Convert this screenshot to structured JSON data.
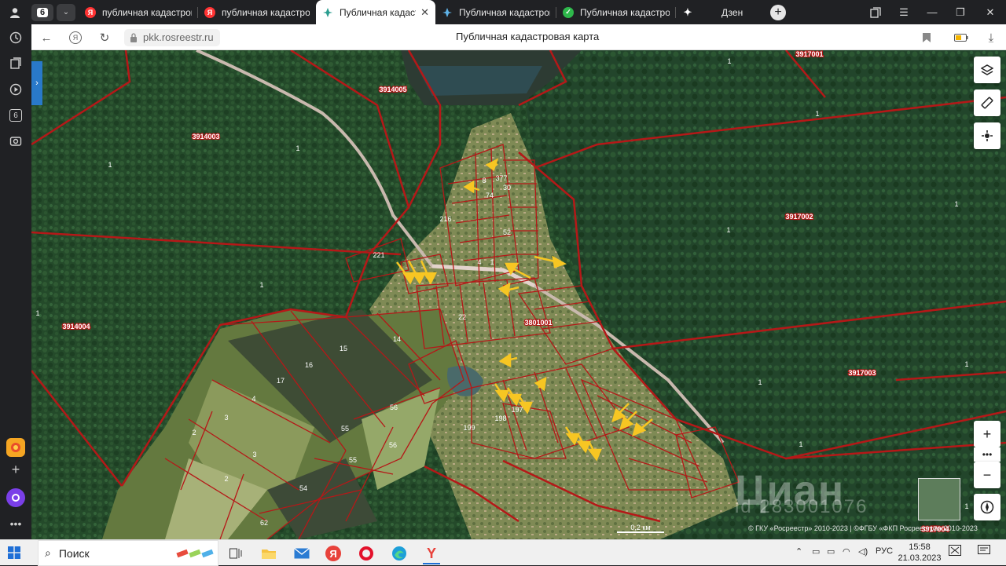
{
  "tabstrip": {
    "tab_count": "6",
    "tabs": [
      {
        "title": "публичная кадастрова",
        "icon": "yandex-icon",
        "active": false
      },
      {
        "title": "публичная кадастрова",
        "icon": "yandex-icon",
        "active": false
      },
      {
        "title": "Публичная кадастро",
        "icon": "rosreestr-icon",
        "active": true
      },
      {
        "title": "Публичная кадастрова",
        "icon": "rosreestr-icon",
        "active": false
      },
      {
        "title": "Публичная кадастрова",
        "icon": "check-icon",
        "active": false
      },
      {
        "title": "Дзен",
        "icon": "dzen-icon",
        "active": false
      }
    ]
  },
  "sidebar": {
    "icons": [
      "history-icon",
      "collections-icon",
      "media-icon",
      "tab-count-icon",
      "screenshot-icon"
    ],
    "tab_count_badge": "6"
  },
  "addressbar": {
    "url": "pkk.rosreestr.ru",
    "page_title": "Публичная кадастровая карта"
  },
  "map": {
    "quarters": [
      "3914005",
      "3914003",
      "3914004",
      "3917001",
      "3917002",
      "3917003",
      "3801001",
      "3917004"
    ],
    "parcel_numbers": [
      "1",
      "1",
      "1",
      "1",
      "1",
      "1",
      "1",
      "1",
      "1",
      "1",
      "1",
      "1",
      "1",
      "221",
      "216",
      "22",
      "15",
      "14",
      "16",
      "17",
      "4",
      "3",
      "3",
      "2",
      "2",
      "55",
      "55",
      "56",
      "56",
      "54",
      "62",
      "199",
      "198",
      "197",
      "74",
      "30",
      "8",
      "4",
      "377",
      "52"
    ],
    "scale_label": "0,2 км",
    "attribution": "© ГКУ «Росреестр» 2010-2023 | ©ФГБУ «ФКП Росреестра» 2010-2023",
    "watermark": "Циан",
    "watermark_id": "id 283001076",
    "controls": [
      "layers-icon",
      "ruler-icon",
      "locate-icon",
      "zoom-in-button",
      "more-icon",
      "zoom-out-button",
      "compass-icon"
    ]
  },
  "taskbar": {
    "search_placeholder": "Поиск",
    "language": "РУС",
    "time": "15:58",
    "date": "21.03.2023"
  }
}
